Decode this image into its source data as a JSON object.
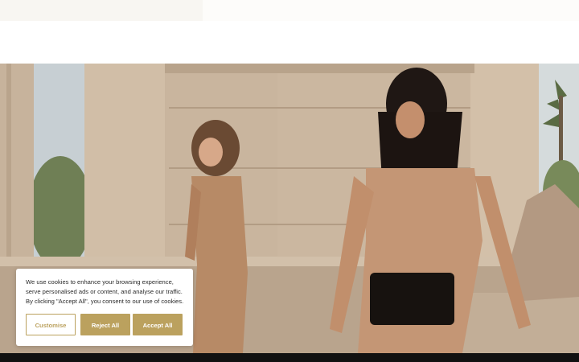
{
  "cookie_banner": {
    "message": "We use cookies to enhance your browsing experience, serve personalised ads or content, and analyse our traffic. By clicking \"Accept All\", you consent to our use of cookies.",
    "customise_label": "Customise",
    "reject_label": "Reject All",
    "accept_label": "Accept All",
    "accent_color": "#bba15e"
  }
}
